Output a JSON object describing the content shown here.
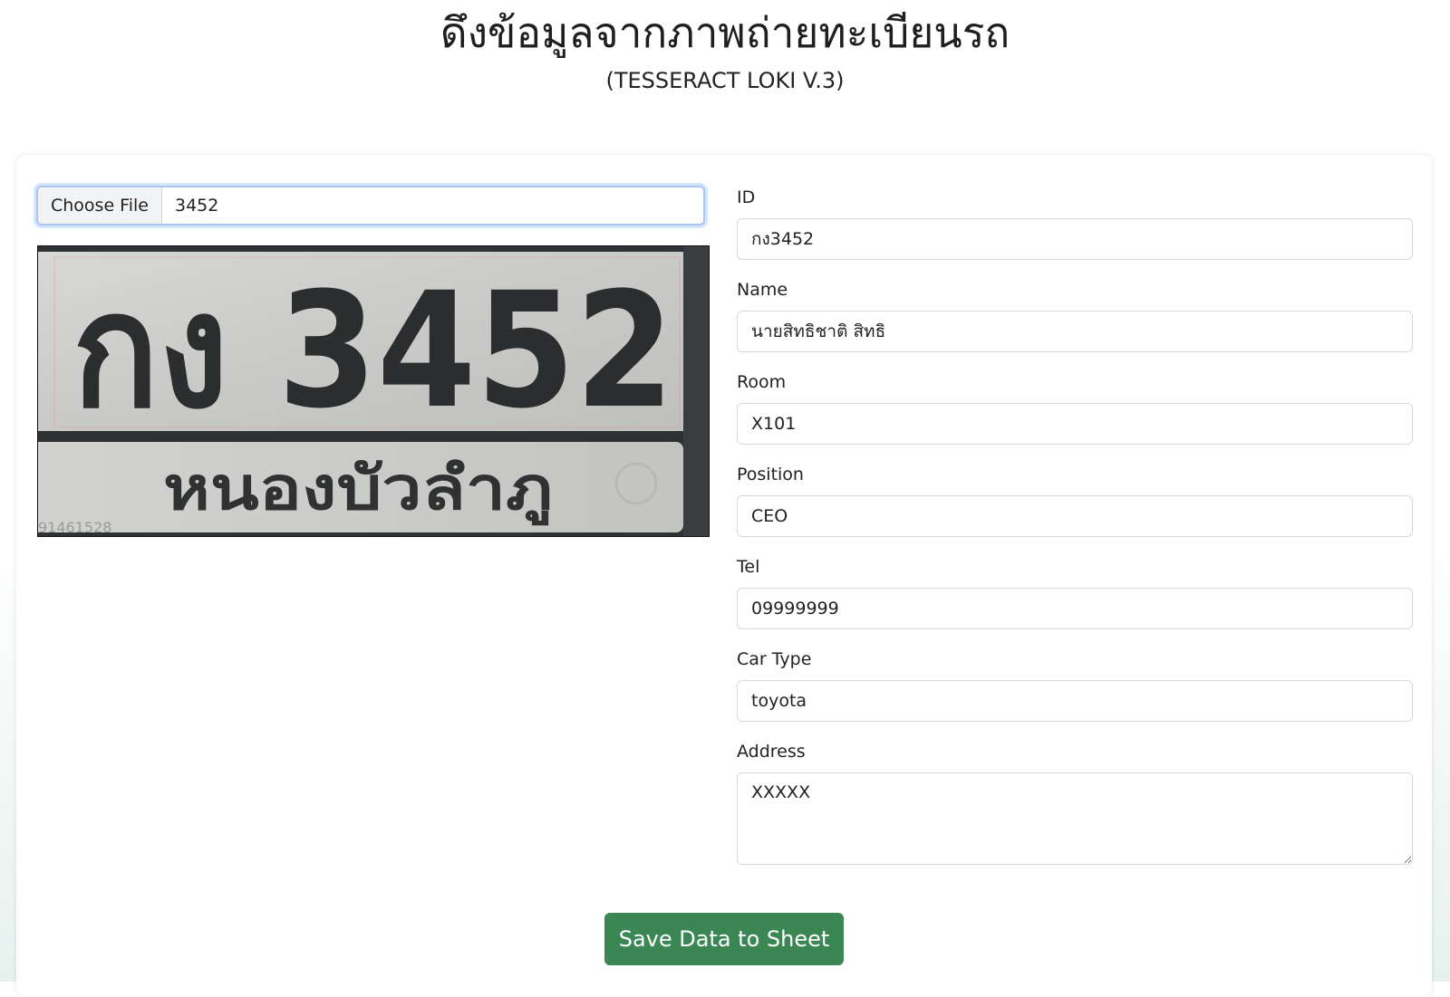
{
  "header": {
    "title": "ดึงข้อมูลจากภาพถ่ายทะเบียนรถ",
    "subtitle": "(TESSERACT LOKI V.3)"
  },
  "upload": {
    "button_label": "Choose File",
    "file_name": "3452"
  },
  "plate_image": {
    "plate_text": "กง 3452",
    "province_text": "หนองบัวลำภู",
    "corner_text": "91461528"
  },
  "form": {
    "fields": [
      {
        "label": "ID",
        "value": "กง3452"
      },
      {
        "label": "Name",
        "value": "นายสิทธิชาติ สิทธิ"
      },
      {
        "label": "Room",
        "value": "X101"
      },
      {
        "label": "Position",
        "value": "CEO"
      },
      {
        "label": "Tel",
        "value": "09999999"
      },
      {
        "label": "Car Type",
        "value": "toyota"
      }
    ],
    "address": {
      "label": "Address",
      "value": "XXXXX"
    }
  },
  "actions": {
    "save_label": "Save Data to Sheet"
  },
  "colors": {
    "save_button": "#3a8754",
    "focus_ring": "#a9c6f1"
  }
}
